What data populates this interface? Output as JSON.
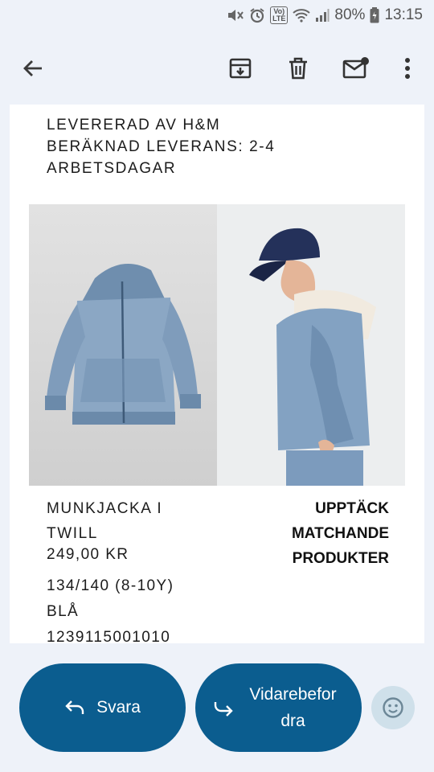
{
  "status_bar": {
    "volte_label": "Vo)\nLTE",
    "battery_text": "80%",
    "time": "13:15",
    "icons": [
      "mute-icon",
      "alarm-icon",
      "volte-icon",
      "wifi-icon",
      "signal-icon",
      "battery-icon"
    ]
  },
  "toolbar": {
    "icons": [
      "back-arrow-icon",
      "archive-icon",
      "trash-icon",
      "mark-unread-icon",
      "more-vert-icon"
    ]
  },
  "email": {
    "delivery_lines": [
      "LEVERERAD AV H&M",
      "BERÄKNAD LEVERANS: 2-4",
      "ARBETSDAGAR"
    ],
    "product": {
      "name_lines": [
        "MUNKJACKA I",
        "TWILL"
      ],
      "price": "249,00 KR",
      "size": "134/140 (8-10Y)",
      "color": "BLÅ",
      "article_number": "1239115001010"
    },
    "discover_lines": [
      "UPPTÄCK",
      "MATCHANDE",
      "PRODUKTER"
    ]
  },
  "actions": {
    "reply_label": "Svara",
    "forward_lines": [
      "Vidarebefor",
      "dra"
    ],
    "emoji_icon": "emoji-reaction-icon"
  },
  "colors": {
    "primary": "#0b5d8f",
    "background": "#eef2f9",
    "emoji_bg": "#cfe0ea"
  }
}
